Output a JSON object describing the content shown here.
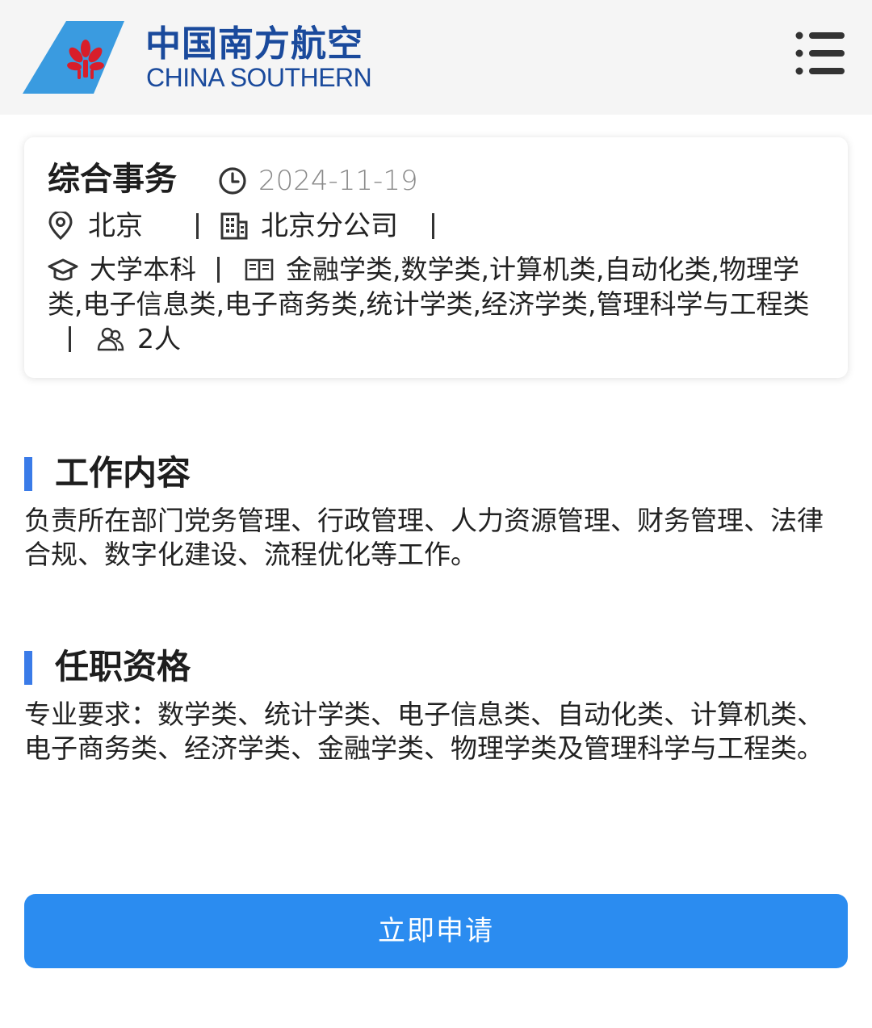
{
  "header": {
    "brand_cn": "中国南方航空",
    "brand_en": "CHINA SOUTHERN",
    "logo_colors": {
      "tail": "#3a9be0",
      "flower": "#d81e2a"
    },
    "menu_icon": "hamburger-menu-icon"
  },
  "job": {
    "title": "综合事务",
    "date": "2024-11-19",
    "location": "北京",
    "company": "北京分公司",
    "education": "大学本科",
    "majors": "金融学类,数学类,计算机类,自动化类,物理学类,电子信息类,电子商务类,统计学类,经济学类,管理科学与工程类",
    "headcount": "2人",
    "icons": {
      "date": "clock-icon",
      "location": "location-pin-icon",
      "company": "building-icon",
      "education": "graduation-cap-icon",
      "majors": "book-icon",
      "headcount": "people-icon"
    }
  },
  "sections": {
    "duties": {
      "title": "工作内容",
      "body": "负责所在部门党务管理、行政管理、人力资源管理、财务管理、法律合规、数字化建设、流程优化等工作。"
    },
    "requirements": {
      "title": "任职资格",
      "body": "专业要求：数学类、统计学类、电子信息类、自动化类、计算机类、电子商务类、经济学类、金融学类、物理学类及管理科学与工程类。"
    }
  },
  "apply_button": {
    "label": "立即申请"
  },
  "colors": {
    "brand_blue": "#1a4a9c",
    "accent_bar": "#3a7be8",
    "button_bg": "#2b8cf0",
    "date_gray": "#8a8a8a",
    "header_bg": "#f5f5f5"
  }
}
